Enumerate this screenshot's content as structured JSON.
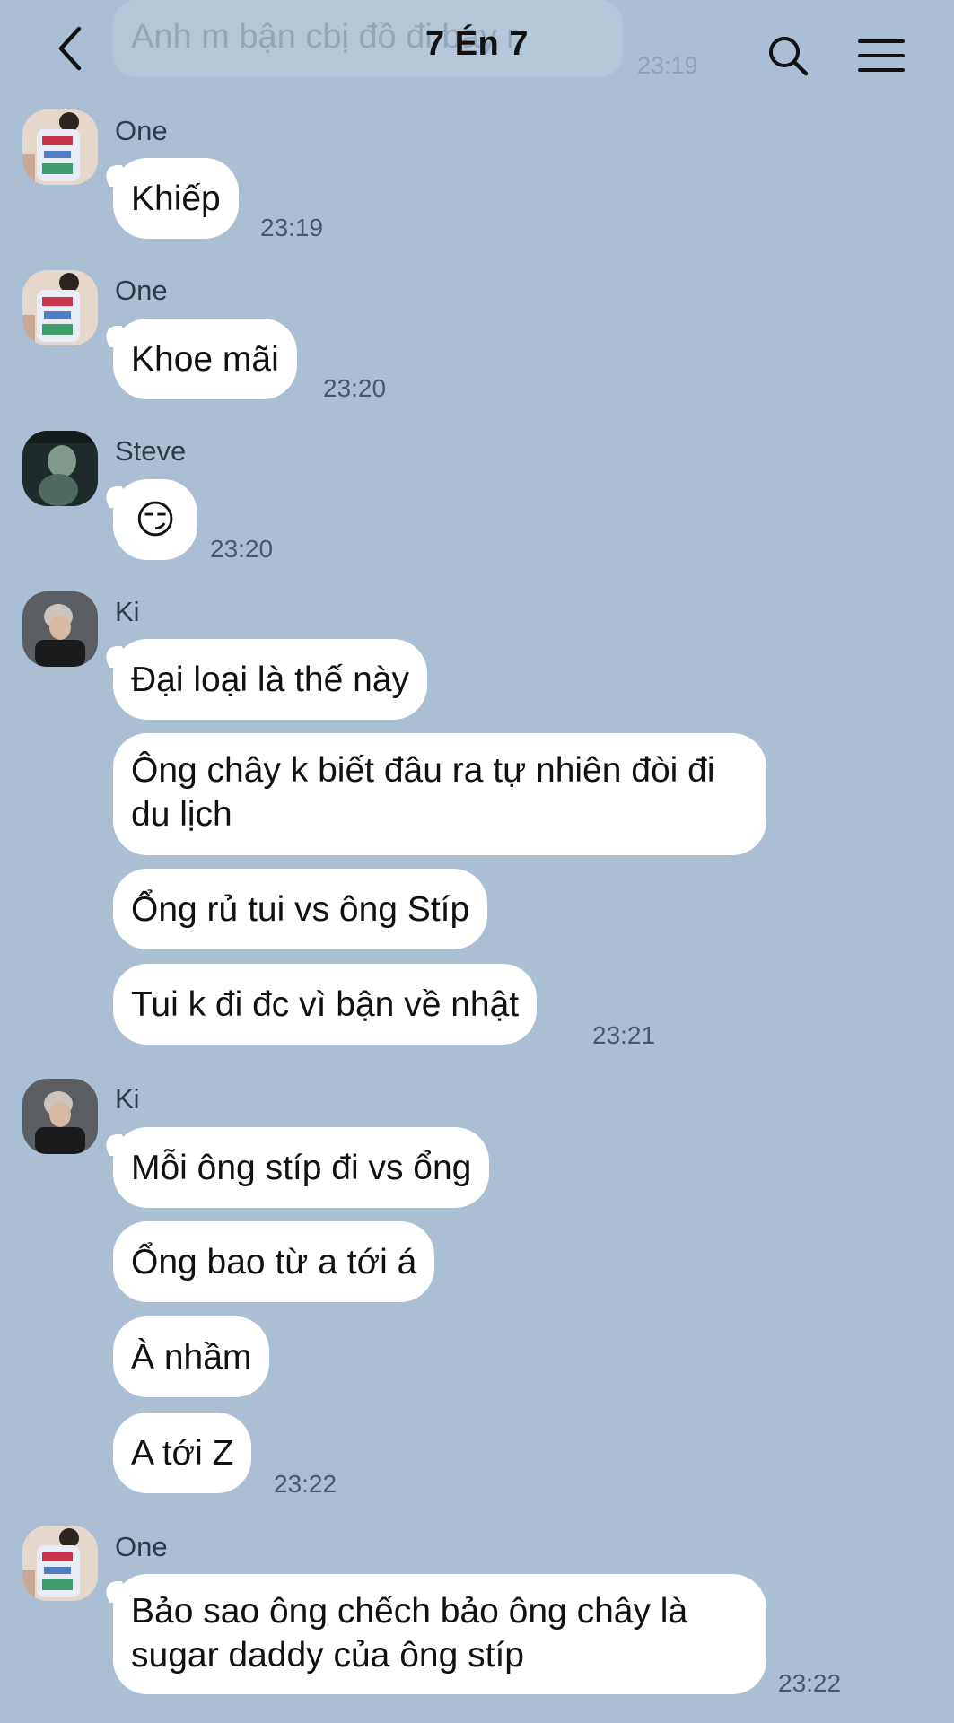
{
  "header": {
    "title": "7 Én 7",
    "back_icon": "chevron-left-icon",
    "search_icon": "search-icon",
    "menu_icon": "hamburger-menu-icon"
  },
  "previous_message": {
    "text": "Anh m bận cbị đồ đi bay r",
    "time": "23:19"
  },
  "groups": [
    {
      "sender": "One",
      "avatar": "avatar-one",
      "messages": [
        "Khiếp"
      ],
      "time": "23:19"
    },
    {
      "sender": "One",
      "avatar": "avatar-one",
      "messages": [
        "Khoe mãi"
      ],
      "time": "23:20"
    },
    {
      "sender": "Steve",
      "avatar": "avatar-steve",
      "messages": [
        "😏"
      ],
      "time": "23:20"
    },
    {
      "sender": "Ki",
      "avatar": "avatar-ki",
      "messages": [
        "Đại loại là thế này",
        "Ông chây k biết đâu ra tự nhiên đòi đi du lịch",
        "Ổng rủ tui vs ông Stíp",
        "Tui k đi đc vì bận về nhật"
      ],
      "time": "23:21"
    },
    {
      "sender": "Ki",
      "avatar": "avatar-ki",
      "messages": [
        "Mỗi ông stíp đi vs ổng",
        "Ổng bao từ a tới á",
        "À nhầm",
        "A tới Z"
      ],
      "time": "23:22"
    },
    {
      "sender": "One",
      "avatar": "avatar-one",
      "messages": [
        "Bảo sao ông chếch bảo ông chây là sugar daddy của ông stíp"
      ],
      "time": "23:22"
    }
  ],
  "colors": {
    "background": "#aabfd3",
    "bubble": "#ffffff",
    "text": "#111111",
    "timestamp": "#4a5866"
  }
}
